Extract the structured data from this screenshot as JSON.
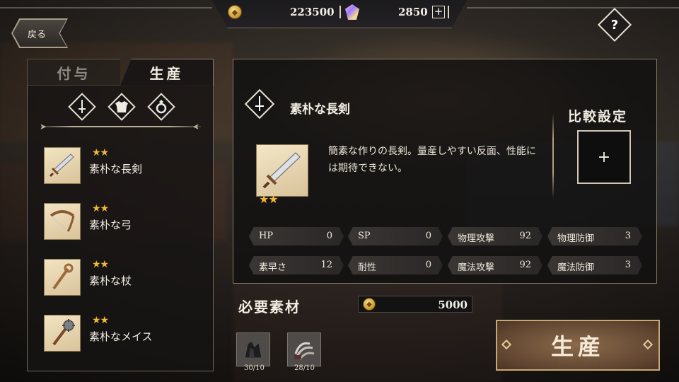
{
  "header": {
    "back_label": "戻る",
    "gold": "223500",
    "gems": "2850",
    "help_label": "?"
  },
  "tabs": [
    {
      "label": "付与",
      "active": false
    },
    {
      "label": "生産",
      "active": true
    }
  ],
  "filters": [
    {
      "icon": "sword-icon"
    },
    {
      "icon": "armor-icon"
    },
    {
      "icon": "ring-icon"
    }
  ],
  "item_list": [
    {
      "stars": "★★",
      "name": "素朴な長剣",
      "icon": "sword-icon"
    },
    {
      "stars": "★★",
      "name": "素朴な弓",
      "icon": "bow-icon"
    },
    {
      "stars": "★★",
      "name": "素朴な杖",
      "icon": "staff-icon"
    },
    {
      "stars": "★★",
      "name": "素朴なメイス",
      "icon": "mace-icon"
    }
  ],
  "selected": {
    "name": "素朴な長剣",
    "stars": "★★",
    "description": "簡素な作りの長剣。量産しやすい反面、性能には期待できない。",
    "stats": [
      {
        "label": "HP",
        "value": "0"
      },
      {
        "label": "SP",
        "value": "0"
      },
      {
        "label": "物理攻撃",
        "value": "92"
      },
      {
        "label": "物理防御",
        "value": "3"
      },
      {
        "label": "素早さ",
        "value": "12"
      },
      {
        "label": "耐性",
        "value": "0"
      },
      {
        "label": "魔法攻撃",
        "value": "92"
      },
      {
        "label": "魔法防御",
        "value": "3"
      }
    ]
  },
  "compare": {
    "label": "比較設定",
    "add": "+"
  },
  "materials": {
    "label": "必要素材",
    "cost": "5000",
    "items": [
      {
        "count": "30/10",
        "icon": "ore-icon"
      },
      {
        "count": "28/10",
        "icon": "claw-icon"
      }
    ]
  },
  "produce_button": "生産",
  "colors": {
    "accent_gold": "#c7a873",
    "star": "#f2b739",
    "panel": "#121111"
  }
}
